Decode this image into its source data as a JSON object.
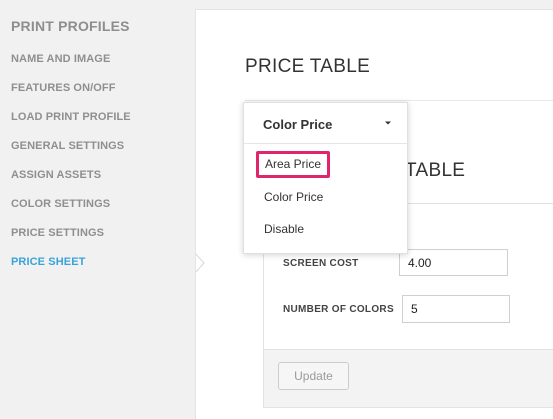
{
  "sidebar": {
    "title": "PRINT PROFILES",
    "items": [
      {
        "label": "NAME AND IMAGE",
        "active": false
      },
      {
        "label": "FEATURES ON/OFF",
        "active": false
      },
      {
        "label": "LOAD PRINT PROFILE",
        "active": false
      },
      {
        "label": "GENERAL SETTINGS",
        "active": false
      },
      {
        "label": "ASSIGN ASSETS",
        "active": false
      },
      {
        "label": "COLOR SETTINGS",
        "active": false
      },
      {
        "label": "PRICE SETTINGS",
        "active": false
      },
      {
        "label": "PRICE SHEET",
        "active": true
      }
    ]
  },
  "main": {
    "heading": "PRICE TABLE",
    "card_heading_partial": "TABLE",
    "fields": [
      {
        "label": "SCREEN COST",
        "value": "4.00"
      },
      {
        "label": "NUMBER OF COLORS",
        "value": "5"
      }
    ],
    "update_label": "Update"
  },
  "dropdown": {
    "selected": "Color Price",
    "options": [
      "Area Price",
      "Color Price",
      "Disable"
    ],
    "highlighted_option": "Area Price"
  },
  "colors": {
    "accent_active": "#3aa3d9",
    "highlight_border": "#e0256d"
  }
}
